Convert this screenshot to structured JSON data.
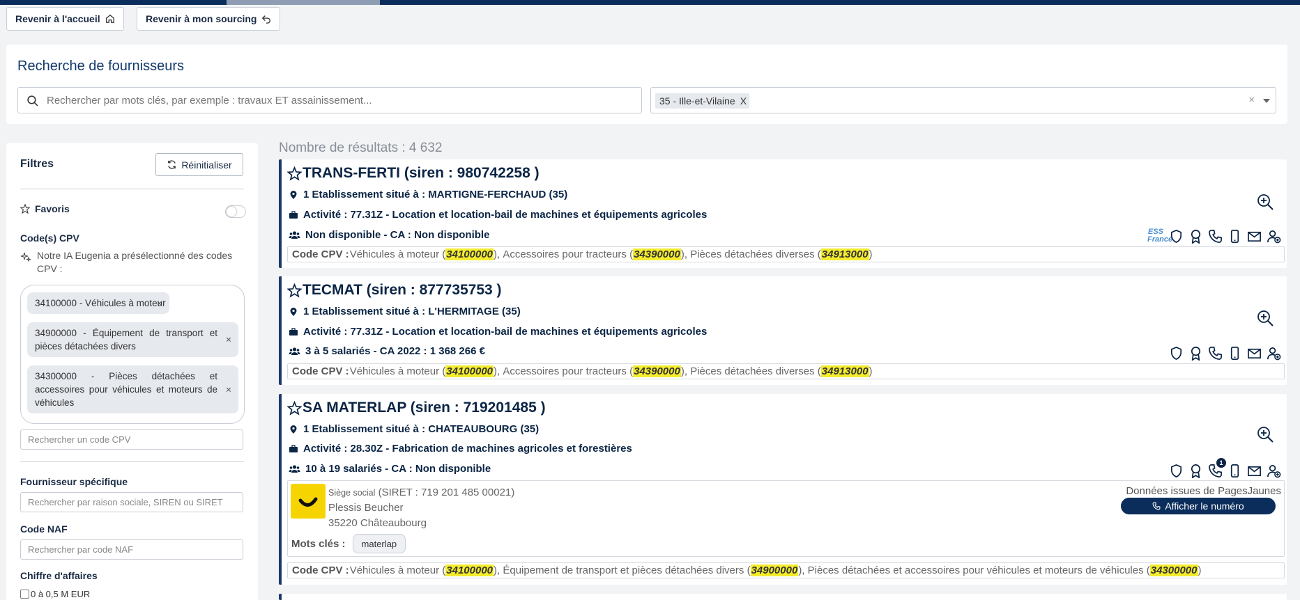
{
  "nav": {
    "home_label": "Revenir à l'accueil",
    "sourcing_label": "Revenir à mon sourcing"
  },
  "search": {
    "title": "Recherche de fournisseurs",
    "placeholder": "Rechercher par mots clés, par exemple : travaux ET assainissement...",
    "region_chip": "35 - Ille-et-Vilaine",
    "region_chip_remove": "X",
    "clear": "×"
  },
  "filters": {
    "title": "Filtres",
    "reset_label": "Réinitialiser",
    "favorites_label": "Favoris",
    "cpv_label": "Code(s) CPV",
    "ai_note": "Notre IA Eugenia a présélectionné des codes CPV :",
    "cpv_chips": [
      "34100000 - Véhicules à moteur",
      "34900000 - Équipement de transport et pièces détachées divers",
      "34300000 - Pièces détachées et accessoires pour véhicules et moteurs de véhicules"
    ],
    "cpv_remove": "×",
    "cpv_search_placeholder": "Rechercher un code CPV",
    "supplier_label": "Fournisseur spécifique",
    "supplier_placeholder": "Rechercher par raison sociale, SIREN ou SIRET",
    "naf_label": "Code NAF",
    "naf_placeholder": "Rechercher par code NAF",
    "ca_label": "Chiffre d'affaires",
    "ca_option": "0 à 0,5 M EUR"
  },
  "results": {
    "count_label": "Nombre de résultats : 4 632",
    "cpv_prefix": "Code CPV :",
    "cards": [
      {
        "title": "TRANS-FERTI (siren : 980742258 )",
        "location": "1 Etablissement situé à : MARTIGNE-FERCHAUD (35)",
        "activity": "Activité : 77.31Z - Location et location-bail de machines et équipements agricoles",
        "size": "Non disponible - CA : Non disponible",
        "ess_badge": "ESS France",
        "cpv": [
          {
            "text": "Véhicules à moteur (",
            "code": "34100000",
            "after": "), "
          },
          {
            "text": "Accessoires pour tracteurs (",
            "code": "34390000",
            "after": "), "
          },
          {
            "text": "Pièces détachées diverses (",
            "code": "34913000",
            "after": ")"
          }
        ]
      },
      {
        "title": "TECMAT (siren : 877735753 )",
        "location": "1 Etablissement situé à : L'HERMITAGE (35)",
        "activity": "Activité : 77.31Z - Location et location-bail de machines et équipements agricoles",
        "size": "3 à 5 salariés - CA 2022 : 1 368 266 €",
        "cpv": [
          {
            "text": "Véhicules à moteur (",
            "code": "34100000",
            "after": "), "
          },
          {
            "text": "Accessoires pour tracteurs (",
            "code": "34390000",
            "after": "), "
          },
          {
            "text": "Pièces détachées diverses (",
            "code": "34913000",
            "after": ")"
          }
        ]
      },
      {
        "title": "SA MATERLAP (siren : 719201485 )",
        "location": "1 Etablissement situé à : CHATEAUBOURG (35)",
        "activity": "Activité : 28.30Z - Fabrication de machines agricoles et forestières",
        "size": "10 à 19 salariés - CA : Non disponible",
        "phone_badge": "1",
        "pagesjaunes": {
          "siege_label": "Siège social",
          "siret": "(SIRET : 719 201 485 00021)",
          "address1": "Plessis Beucher",
          "address2": "35220 Châteaubourg",
          "source": "Données issues de PagesJaunes",
          "call_label": "Afficher le numéro",
          "keywords_label": "Mots clés :",
          "keywords": [
            "materlap"
          ]
        },
        "cpv": [
          {
            "text": "Véhicules à moteur (",
            "code": "34100000",
            "after": "), "
          },
          {
            "text": "Équipement de transport et pièces détachées divers (",
            "code": "34900000",
            "after": "), "
          },
          {
            "text": "Pièces détachées et accessoires pour véhicules et moteurs de véhicules (",
            "code": "34300000",
            "after": ")"
          }
        ]
      }
    ]
  },
  "colors": {
    "primary": "#0b2545",
    "accent_bar": "#0b2d5b",
    "highlight": "#f4ec2c",
    "pagesjaunes": "#f6d400"
  }
}
